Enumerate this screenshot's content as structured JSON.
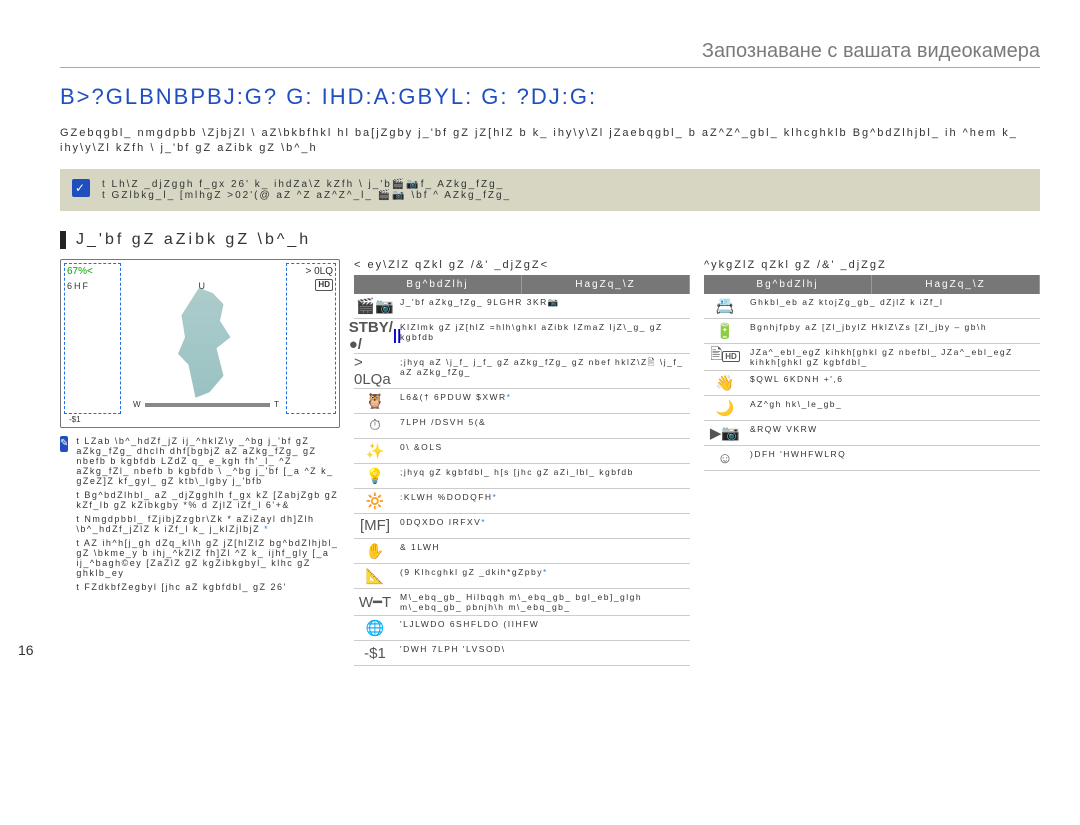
{
  "header": {
    "breadcrumb": "Запознаване с вашата видеокамера"
  },
  "title": "B>?GLBNBPBJ:G? G: IHD:A:GBYL: G: ?DJ:G:",
  "intro": "GZebqgbl_ nmgdpbb \\ZjbjZl \\ aZ\\bkbfhkl hl ba[jZgby j_'bf gZ jZ[hlZ b k_ ihy\\y\\Zl jZaebqgbl_ b aZ^Z^_gbl_ klhcghklb  Bg^bdZlhjbl_ ih ^hem k_ ihy\\y\\Zl kZfh \\ j_'bf gZ aZibk gZ \\b^_h",
  "tipbox": {
    "line1": "t  Lh\\Z _djZggh f_gx 26' k_ ihdZa\\Z kZfh \\ j_'b🎬📷f_ AZkg_fZg_",
    "line2": "t  GZlbkg_l_ [mlhgZ >02'(@ aZ ^Z aZ^Z^_l_ 🎬📷 \\bf ^ AZkg_fZg_"
  },
  "section_title": "J_'bf gZ aZibk gZ \\b^_h",
  "screen": {
    "pct": "67%<",
    "topright": "> 0LQ",
    "sec_left": "6HF",
    "u_label": "U",
    "san": "-$1",
    "w": "W",
    "t": "T"
  },
  "mid_header": "< ey\\ZlZ qZkl gZ /&' _djZgZ<",
  "right_header": "^ykgZlZ qZkl gZ /&' _djZgZ",
  "table_headers": {
    "ind": "Bg^bdZlhj",
    "desc": "HagZq_\\Z"
  },
  "mid_rows": [
    {
      "icon": "🎬📷",
      "desc": "J_'bf aZkg_fZg_ 9LGHR 3KR📷"
    },
    {
      "icon": "STBY",
      "desc": "KlZlmk gZ jZ[hlZ  =hlh\\ghkl aZibk IZmaZ  IjZ\\_g_ gZ kgbfdb"
    },
    {
      "icon": "> 0LQa",
      "desc": ";jhyq aZ \\j_f_ j_f_ gZ aZkg_fZg_ gZ nbef hklZ\\Z🖹 \\j_f_ aZ aZkg_fZg_"
    },
    {
      "icon": "🦉",
      "desc": "L6&(†   6PDUW $XWR"
    },
    {
      "icon": "⏱",
      "desc": "7LPH /DSVH 5(&"
    },
    {
      "icon": "✨",
      "desc": "0\\ &OLS"
    },
    {
      "icon": "💡",
      "desc": ";jhyq gZ kgbfdbl_ h[s [jhc gZ aZi_lbl_ kgbfdb"
    },
    {
      "icon": "🔆",
      "desc": ":KLWH %DODQFH"
    },
    {
      "icon": "[MF]",
      "desc": "0DQXDO IRFXV"
    },
    {
      "icon": "✋",
      "desc": "& 1LWH"
    },
    {
      "icon": "📐",
      "desc": "(9  Klhcghkl gZ _dkih*gZpby"
    },
    {
      "icon": "W━T",
      "desc": "M\\_ebq_gb_  Hilbqgh m\\_ebq_gb_  bgl_eb]_glgh m\\_ebq_gb_  pbnjh\\h m\\_ebq_gb_"
    },
    {
      "icon": "🌐",
      "desc": "'LJLWDO 6SHFLDO (IIHFW"
    },
    {
      "icon": "-$1",
      "desc": "'DWH 7LPH 'LVSOD\\"
    }
  ],
  "right_rows": [
    {
      "icon": "📇",
      "desc": "Ghkbl_eb aZ ktojZg_gb_ dZjlZ k iZf_l"
    },
    {
      "icon": "🔋",
      "desc": "Bgnhjfpby aZ [Zl_jbylZ  HklZ\\Zs [Zl_jby – gb\\h"
    },
    {
      "icon": "🖹 HD",
      "desc": "JZa^_ebl_egZ kihkh[ghkl gZ nbefbl_  JZa^_ebl_egZ kihkh[ghkl gZ kgbfdbl_"
    },
    {
      "icon": "👋",
      "desc": "$QWL 6KDNH +',6"
    },
    {
      "icon": "🌙",
      "desc": "AZ^gh hk\\_le_gb_"
    },
    {
      "icon": "▶📷",
      "desc": "&RQW  VKRW"
    },
    {
      "icon": "☺",
      "desc": ")DFH 'HWHFWLRQ"
    }
  ],
  "notes": [
    "t  LZab \\b^_hdZf_jZ ij_^hklZ\\y _^bg j_'bf gZ aZkg_fZg_  dhclh  dhf[bgbjZ aZ aZkg_fZg_ gZ nbefb b kgbfdb LZdZ q_ e_kgh fh'_l_ ^Z aZkg_fZl_ nbefb b kgbfdb \\ _^bg j_'bf [_a ^Z k_ gZeZ]Z kf_gyl_ gZ ktb\\_lgby j_'bfb",
    "t  Bg^bdZlhbl_ aZ _djZgghlh f_gx kZ [ZabjZgb gZ kZf_lb gZ kZibkgby   *%  d ZjlZ  iZf_l  6'+&",
    "t  Nmgdpbbl_   fZjibjZzgbr\\Zk *  aZiZayl dh]Zlh \\b^_hdZf_jZlZ k iZf_l k_ j_klZjlbjZ",
    "t  AZ ih^h[j_gh dZq_kl\\h gZ jZ[hlZlZ bg^bdZlhjbl_ gZ \\bkme_y b ihj_^kZlZ fh]Zl ^Z k_ ijhf_gly [_a ij_^bagh©ey [ZaZlZ gZ kgZibkgbyl_ klhc gZ ghklb_ey",
    "t  FZdkbfZegbyl [jhc aZ kgbfdbl_ gZ 26'"
  ],
  "pagenum": "16"
}
